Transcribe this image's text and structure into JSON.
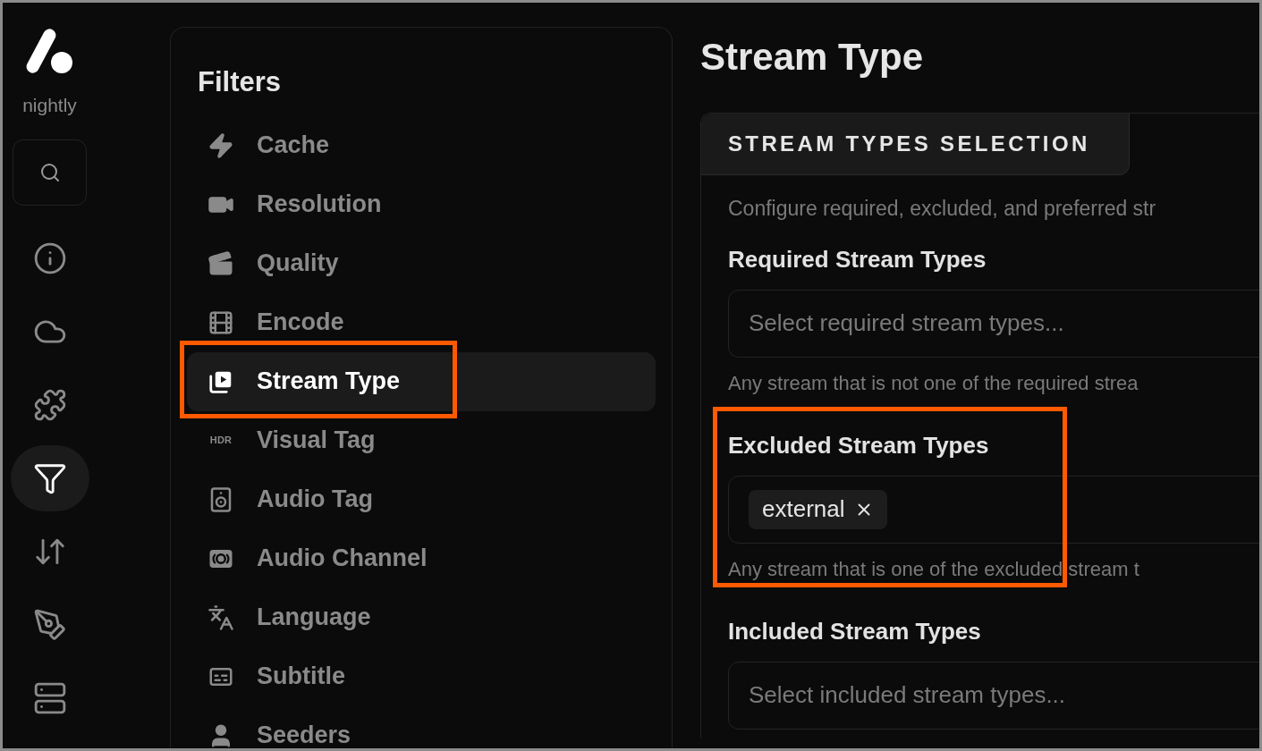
{
  "app": {
    "name": "nightly"
  },
  "rail": [
    {
      "selected": false
    },
    {
      "selected": false
    },
    {
      "selected": false
    },
    {
      "selected": true
    },
    {
      "selected": false
    },
    {
      "selected": false
    },
    {
      "selected": false
    }
  ],
  "sidebar": {
    "title": "Filters",
    "items": [
      {
        "label": "Cache",
        "selected": false,
        "highlighted": false
      },
      {
        "label": "Resolution",
        "selected": false,
        "highlighted": false
      },
      {
        "label": "Quality",
        "selected": false,
        "highlighted": false
      },
      {
        "label": "Encode",
        "selected": false,
        "highlighted": false
      },
      {
        "label": "Stream Type",
        "selected": true,
        "highlighted": true
      },
      {
        "label": "Visual Tag",
        "icon_text": "HDR",
        "selected": false,
        "highlighted": false
      },
      {
        "label": "Audio Tag",
        "selected": false,
        "highlighted": false
      },
      {
        "label": "Audio Channel",
        "selected": false,
        "highlighted": false
      },
      {
        "label": "Language",
        "selected": false,
        "highlighted": false
      },
      {
        "label": "Subtitle",
        "selected": false,
        "highlighted": false
      },
      {
        "label": "Seeders",
        "selected": false,
        "highlighted": false
      }
    ]
  },
  "page": {
    "title": "Stream Type",
    "card": {
      "tab": "STREAM TYPES SELECTION",
      "description": "Configure required, excluded, and preferred str",
      "sections": [
        {
          "label": "Required Stream Types",
          "placeholder": "Select required stream types...",
          "help": "Any stream that is not one of the required strea",
          "highlighted": false
        },
        {
          "label": "Excluded Stream Types",
          "values": [
            "external"
          ],
          "help": "Any stream that is one of the excluded stream t",
          "highlighted": true
        },
        {
          "label": "Included Stream Types",
          "placeholder": "Select included stream types...",
          "highlighted": false
        }
      ]
    }
  }
}
